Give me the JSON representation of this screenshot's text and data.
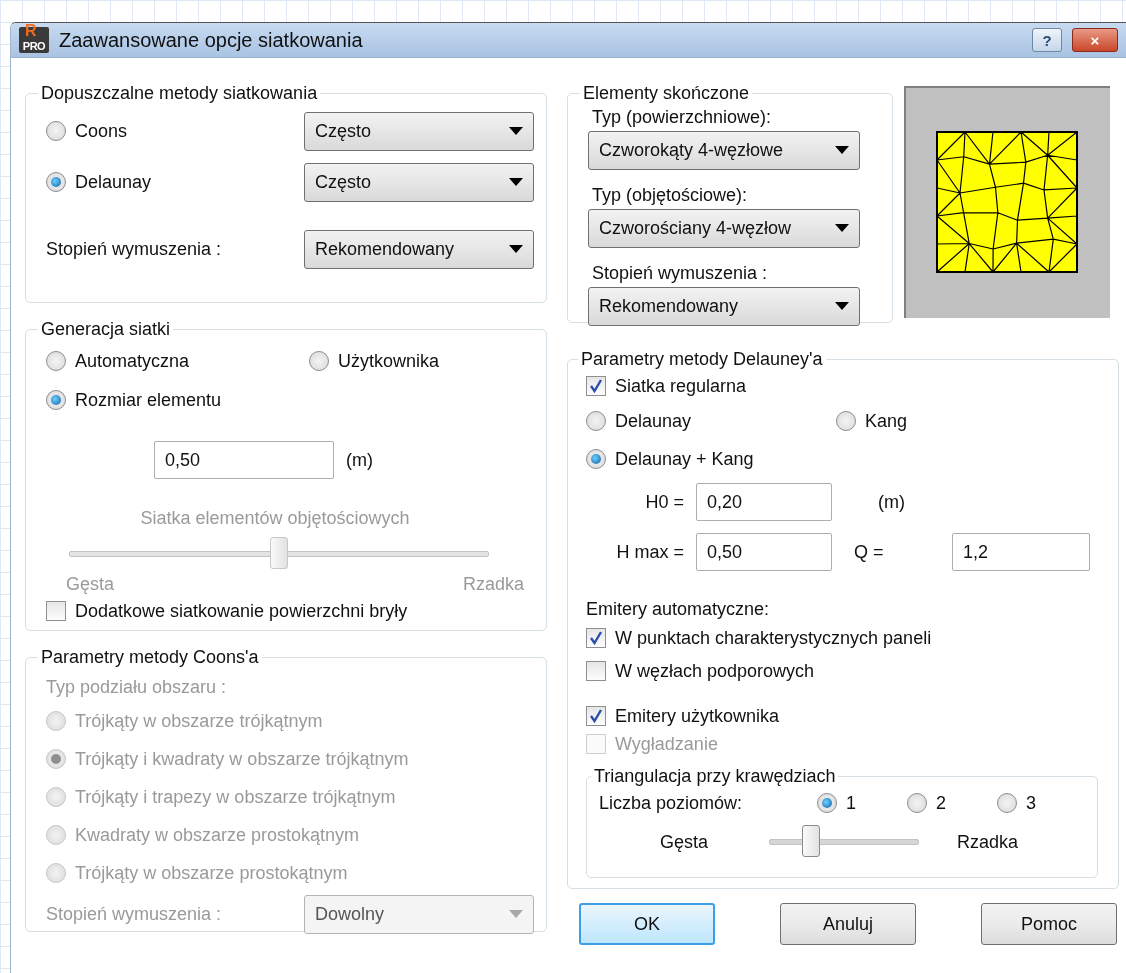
{
  "window": {
    "logo_top": "R",
    "logo_bottom": "PRO",
    "title": "Zaawansowane opcje siatkowania",
    "help_button": "?",
    "close_button": "×"
  },
  "methods": {
    "title": "Dopuszczalne metody siatkowania",
    "rows": [
      {
        "label": "Coons",
        "selected": false,
        "value": "Często"
      },
      {
        "label": "Delaunay",
        "selected": true,
        "value": "Często"
      }
    ],
    "forcing_label": "Stopień wymuszenia :",
    "forcing_value": "Rekomendowany"
  },
  "generation": {
    "title": "Generacja siatki",
    "options": [
      {
        "label": "Automatyczna",
        "selected": false
      },
      {
        "label": "Użytkownika",
        "selected": false
      },
      {
        "label": "Rozmiar elementu",
        "selected": true
      }
    ],
    "size_value": "0,50",
    "size_unit": "(m)",
    "slider": {
      "label": "Siatka elementów objętościowych",
      "level": 0.5,
      "min_label": "Gęsta",
      "max_label": "Rzadka",
      "disabled": true
    },
    "extra": {
      "label": "Dodatkowe siatkowanie powierzchni bryły",
      "checked": false
    }
  },
  "coons": {
    "title": "Parametry metody Coons'a",
    "disabled": true,
    "subtitle": "Typ podziału obszaru :",
    "options": [
      {
        "label": "Trójkąty w obszarze trójkątnym",
        "selected": false
      },
      {
        "label": "Trójkąty i kwadraty w obszarze trójkątnym",
        "selected": true
      },
      {
        "label": "Trójkąty i trapezy w obszarze trójkątnym",
        "selected": false
      },
      {
        "label": "Kwadraty w obszarze prostokątnym",
        "selected": false
      },
      {
        "label": "Trójkąty w obszarze prostokątnym",
        "selected": false
      }
    ],
    "forcing_label": "Stopień wymuszenia :",
    "forcing_value": "Dowolny"
  },
  "elements": {
    "title": "Elementy skończone",
    "fields": [
      {
        "label": "Typ (powierzchniowe):",
        "value": "Czworokąty 4-węzłowe"
      },
      {
        "label": "Typ (objętościowe):",
        "value": "Czworościany 4-węzłow"
      },
      {
        "label": "Stopień wymuszenia :",
        "value": "Rekomendowany"
      }
    ]
  },
  "delaunay": {
    "title": "Parametry metody Delauney'a",
    "regular": {
      "label": "Siatka regularna",
      "checked": true
    },
    "options": [
      {
        "label": "Delaunay",
        "selected": false
      },
      {
        "label": "Kang",
        "selected": false
      },
      {
        "label": "Delaunay + Kang",
        "selected": true
      }
    ],
    "h0_label": "H0 =",
    "h0_value": "0,20",
    "h0_unit": "(m)",
    "hmax_label": "H max =",
    "hmax_value": "0,50",
    "q_label": "Q =",
    "q_value": "1,2",
    "emitters_title": "Emitery automatyczne:",
    "emitters": [
      {
        "label": "W punktach charakterystycznych paneli",
        "checked": true,
        "disabled": false
      },
      {
        "label": "W węzłach podporowych",
        "checked": false,
        "disabled": false
      }
    ],
    "user_options": [
      {
        "label": "Emitery użytkownika",
        "checked": true,
        "disabled": false
      },
      {
        "label": "Wygładzanie",
        "checked": false,
        "disabled": true
      }
    ],
    "edges": {
      "title": "Triangulacja przy krawędziach",
      "levels_label": "Liczba poziomów:",
      "levels": [
        {
          "label": "1",
          "selected": true
        },
        {
          "label": "2",
          "selected": false
        },
        {
          "label": "3",
          "selected": false
        }
      ],
      "slider": {
        "level": 0.28,
        "min_label": "Gęsta",
        "max_label": "Rzadka"
      }
    }
  },
  "buttons": [
    {
      "label": "OK",
      "default": true
    },
    {
      "label": "Anuluj",
      "default": false
    },
    {
      "label": "Pomoc",
      "default": false
    }
  ]
}
